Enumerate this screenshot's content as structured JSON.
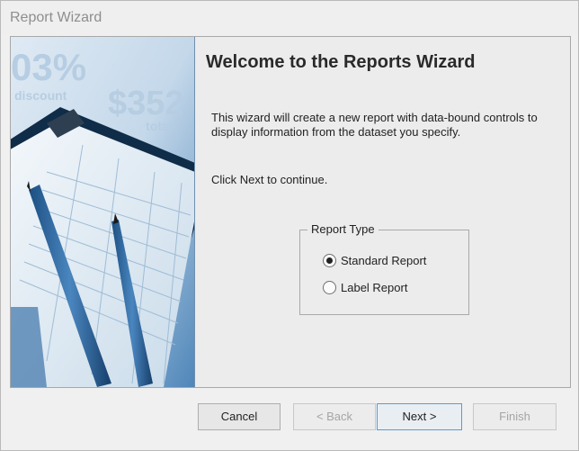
{
  "window": {
    "title": "Report Wizard"
  },
  "header": {
    "title": "Welcome to the Reports Wizard"
  },
  "body": {
    "description": "This wizard will create a new report with data-bound controls to display information from the dataset you specify.",
    "continue_text": "Click Next to continue."
  },
  "report_type": {
    "legend": "Report Type",
    "options": [
      {
        "label": "Standard Report",
        "selected": true
      },
      {
        "label": "Label Report",
        "selected": false
      }
    ]
  },
  "banner": {
    "icon": "clipboard-pens-illustration",
    "text_discount_pct": "03%",
    "text_discount": "discount",
    "text_price": "$352",
    "text_total": "total"
  },
  "buttons": {
    "cancel": "Cancel",
    "back": "< Back",
    "next": "Next >",
    "finish": "Finish"
  },
  "colors": {
    "banner_blue": "#2f6aa3",
    "focus_border": "#5a9bd5"
  }
}
